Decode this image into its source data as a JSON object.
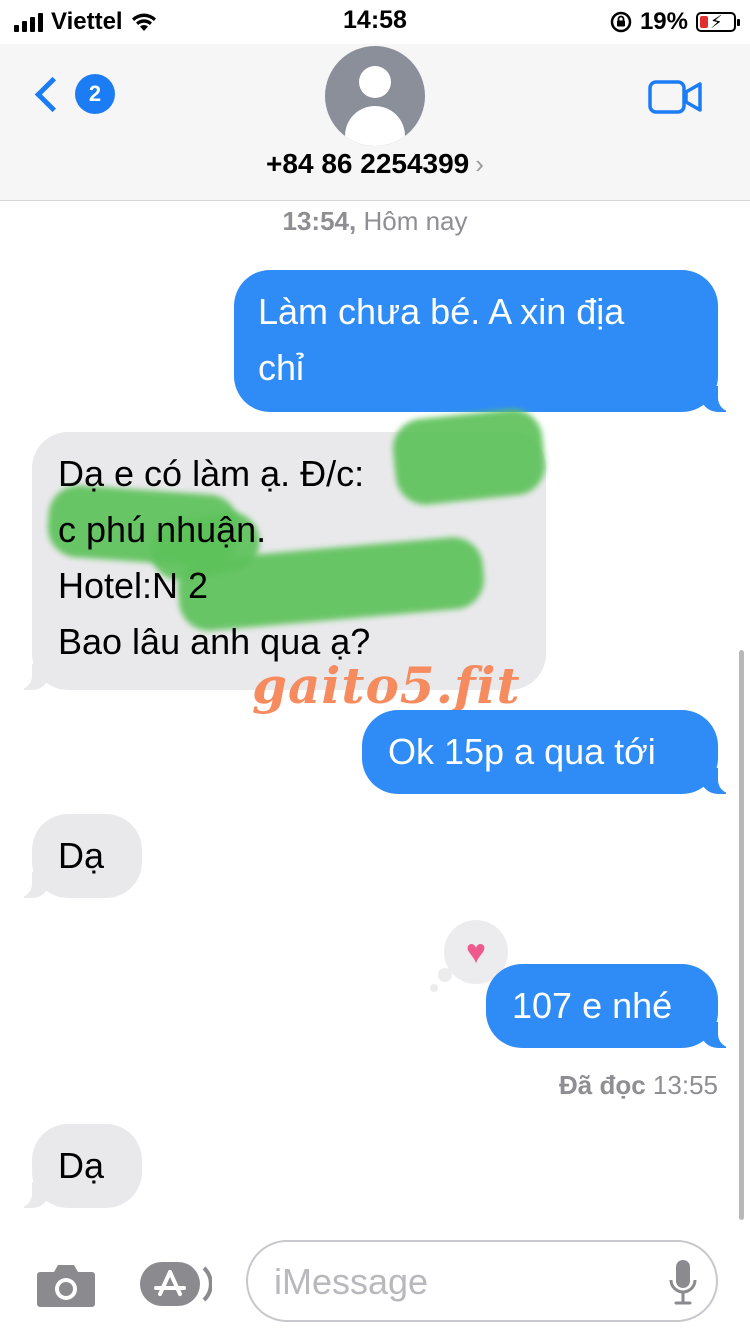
{
  "status_bar": {
    "carrier": "Viettel",
    "time": "14:58",
    "battery_percent": "19%",
    "battery_level": 0.19
  },
  "header": {
    "back_badge": "2",
    "contact": "+84 86 2254399",
    "icons": [
      "back-chevron-icon",
      "avatar-placeholder-icon",
      "chevron-right-icon",
      "video-call-icon"
    ]
  },
  "thread": {
    "timestamp_time": "13:54,",
    "timestamp_day": "Hôm nay",
    "messages": [
      {
        "from": "me",
        "text": "Làm chưa bé. A xin địa\nchỉ"
      },
      {
        "from": "them",
        "text": "Dạ e có làm ạ. Đ/c:\nc phú nhuận.\nHotel:N 2\nBao lâu anh qua ạ?"
      },
      {
        "from": "me",
        "text": "Ok 15p a qua tới"
      },
      {
        "from": "them",
        "text": "Dạ"
      },
      {
        "from": "me",
        "text": "107 e nhé",
        "reaction": "heart"
      },
      {
        "from": "them",
        "text": "Dạ"
      }
    ],
    "read_label": "Đã đọc",
    "read_time": "13:55",
    "watermark": "gaito5.fit"
  },
  "input_bar": {
    "placeholder": "iMessage",
    "icons": [
      "camera-icon",
      "app-store-icon",
      "microphone-icon"
    ]
  },
  "colors": {
    "sent_bubble": "#2f8cf6",
    "received_bubble": "#e9e9eb",
    "accent": "#1c7cf4",
    "redaction": "#5ec25b",
    "watermark": "#f58b5e"
  }
}
